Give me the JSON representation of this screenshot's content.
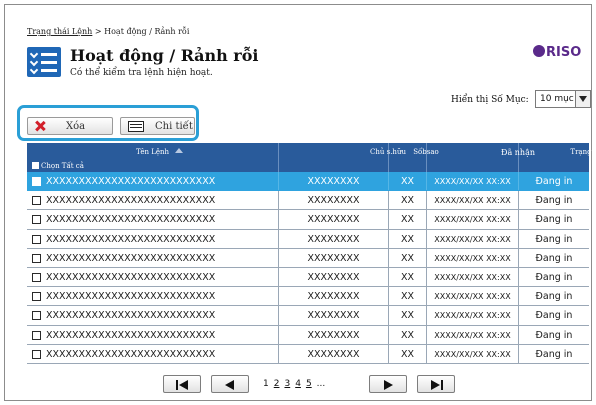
{
  "breadcrumb": {
    "parent": "Trạng thái Lệnh",
    "separator": " > ",
    "current": "Hoạt động / Rảnh rỗi"
  },
  "header": {
    "title": "Hoạt động / Rảnh rỗi",
    "subtitle": "Có thể kiểm tra lệnh hiện hoạt.",
    "logo": "RISO"
  },
  "display": {
    "items_label": "Hiển thị Số Mục:",
    "items_value": "10 mục"
  },
  "actions": {
    "delete_label": "Xóa",
    "detail_label": "Chi tiết"
  },
  "table": {
    "columns": [
      "Tên Lệnh",
      "Chủ s.hữu",
      "Sốbsao",
      "Đã nhận",
      "Trạng thái"
    ],
    "select_all_label": "Chọn Tất cả",
    "rows": [
      {
        "name": "XXXXXXXXXXXXXXXXXXXXXXXXXX",
        "owner": "XXXXXXXX",
        "copies": "XX",
        "received": "XXXX/XX/XX XX:XX",
        "status": "Đang in"
      },
      {
        "name": "XXXXXXXXXXXXXXXXXXXXXXXXXX",
        "owner": "XXXXXXXX",
        "copies": "XX",
        "received": "XXXX/XX/XX XX:XX",
        "status": "Đang in"
      },
      {
        "name": "XXXXXXXXXXXXXXXXXXXXXXXXXX",
        "owner": "XXXXXXXX",
        "copies": "XX",
        "received": "XXXX/XX/XX XX:XX",
        "status": "Đang in"
      },
      {
        "name": "XXXXXXXXXXXXXXXXXXXXXXXXXX",
        "owner": "XXXXXXXX",
        "copies": "XX",
        "received": "XXXX/XX/XX XX:XX",
        "status": "Đang in"
      },
      {
        "name": "XXXXXXXXXXXXXXXXXXXXXXXXXX",
        "owner": "XXXXXXXX",
        "copies": "XX",
        "received": "XXXX/XX/XX XX:XX",
        "status": "Đang in"
      },
      {
        "name": "XXXXXXXXXXXXXXXXXXXXXXXXXX",
        "owner": "XXXXXXXX",
        "copies": "XX",
        "received": "XXXX/XX/XX XX:XX",
        "status": "Đang in"
      },
      {
        "name": "XXXXXXXXXXXXXXXXXXXXXXXXXX",
        "owner": "XXXXXXXX",
        "copies": "XX",
        "received": "XXXX/XX/XX XX:XX",
        "status": "Đang in"
      },
      {
        "name": "XXXXXXXXXXXXXXXXXXXXXXXXXX",
        "owner": "XXXXXXXX",
        "copies": "XX",
        "received": "XXXX/XX/XX XX:XX",
        "status": "Đang in"
      },
      {
        "name": "XXXXXXXXXXXXXXXXXXXXXXXXXX",
        "owner": "XXXXXXXX",
        "copies": "XX",
        "received": "XXXX/XX/XX XX:XX",
        "status": "Đang in"
      },
      {
        "name": "XXXXXXXXXXXXXXXXXXXXXXXXXX",
        "owner": "XXXXXXXX",
        "copies": "XX",
        "received": "XXXX/XX/XX XX:XX",
        "status": "Đang in"
      }
    ]
  },
  "pagination": {
    "current": "1",
    "pages": [
      "2",
      "3",
      "4",
      "5"
    ],
    "ellipsis": "..."
  },
  "colors": {
    "header_blue": "#295b9b",
    "selected_row": "#2fa3df",
    "highlight_border": "#2a9fd6",
    "logo": "#5a2a8a",
    "delete_red": "#d21f2a"
  }
}
